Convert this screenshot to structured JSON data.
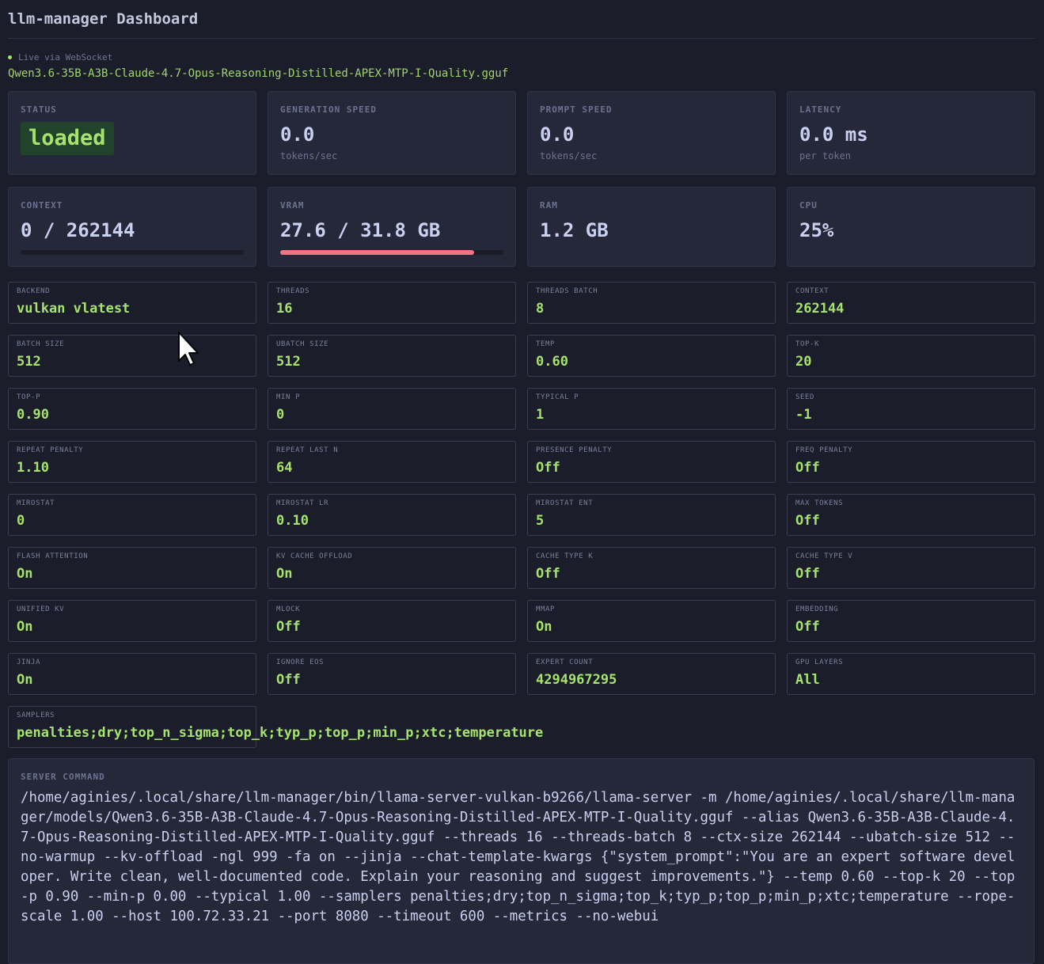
{
  "header": {
    "title": "llm-manager Dashboard"
  },
  "connection": {
    "status_text": "Live via WebSocket",
    "color": "#a6e36e"
  },
  "model": {
    "file": "Qwen3.6-35B-A3B-Claude-4.7-Opus-Reasoning-Distilled-APEX-MTP-I-Quality.gguf"
  },
  "stats": {
    "status": {
      "label": "STATUS",
      "value": "loaded"
    },
    "generation_speed": {
      "label": "GENERATION SPEED",
      "value": "0.0",
      "unit": "tokens/sec"
    },
    "prompt_speed": {
      "label": "PROMPT SPEED",
      "value": "0.0",
      "unit": "tokens/sec"
    },
    "latency": {
      "label": "LATENCY",
      "value": "0.0 ms",
      "unit": "per token"
    },
    "context": {
      "label": "CONTEXT",
      "value": "0 / 262144",
      "used_fraction": 0.0
    },
    "vram": {
      "label": "VRAM",
      "value": "27.6 / 31.8 GB",
      "used_fraction": 0.868
    },
    "ram": {
      "label": "RAM",
      "value": "1.2 GB"
    },
    "cpu": {
      "label": "CPU",
      "value": "25%"
    }
  },
  "config": [
    {
      "label": "BACKEND",
      "value": "vulkan vlatest"
    },
    {
      "label": "THREADS",
      "value": "16"
    },
    {
      "label": "THREADS BATCH",
      "value": "8"
    },
    {
      "label": "CONTEXT",
      "value": "262144"
    },
    {
      "label": "BATCH SIZE",
      "value": "512"
    },
    {
      "label": "UBATCH SIZE",
      "value": "512"
    },
    {
      "label": "TEMP",
      "value": "0.60"
    },
    {
      "label": "TOP-K",
      "value": "20"
    },
    {
      "label": "TOP-P",
      "value": "0.90"
    },
    {
      "label": "MIN P",
      "value": "0"
    },
    {
      "label": "TYPICAL P",
      "value": "1"
    },
    {
      "label": "SEED",
      "value": "-1"
    },
    {
      "label": "REPEAT PENALTY",
      "value": "1.10"
    },
    {
      "label": "REPEAT LAST N",
      "value": "64"
    },
    {
      "label": "PRESENCE PENALTY",
      "value": "Off"
    },
    {
      "label": "FREQ PENALTY",
      "value": "Off"
    },
    {
      "label": "MIROSTAT",
      "value": "0"
    },
    {
      "label": "MIROSTAT LR",
      "value": "0.10"
    },
    {
      "label": "MIROSTAT ENT",
      "value": "5"
    },
    {
      "label": "MAX TOKENS",
      "value": "Off"
    },
    {
      "label": "FLASH ATTENTION",
      "value": "On"
    },
    {
      "label": "KV CACHE OFFLOAD",
      "value": "On"
    },
    {
      "label": "CACHE TYPE K",
      "value": "Off"
    },
    {
      "label": "CACHE TYPE V",
      "value": "Off"
    },
    {
      "label": "UNIFIED KV",
      "value": "On"
    },
    {
      "label": "MLOCK",
      "value": "Off"
    },
    {
      "label": "MMAP",
      "value": "On"
    },
    {
      "label": "EMBEDDING",
      "value": "Off"
    },
    {
      "label": "JINJA",
      "value": "On"
    },
    {
      "label": "IGNORE EOS",
      "value": "Off"
    },
    {
      "label": "EXPERT COUNT",
      "value": "4294967295"
    },
    {
      "label": "GPU LAYERS",
      "value": "All"
    },
    {
      "label": "SAMPLERS",
      "value": "penalties;dry;top_n_sigma;top_k;typ_p;top_p;min_p;xtc;temperature"
    }
  ],
  "server_command": {
    "label": "SERVER COMMAND",
    "text": "/home/aginies/.local/share/llm-manager/bin/llama-server-vulkan-b9266/llama-server -m /home/aginies/.local/share/llm-manager/models/Qwen3.6-35B-A3B-Claude-4.7-Opus-Reasoning-Distilled-APEX-MTP-I-Quality.gguf --alias Qwen3.6-35B-A3B-Claude-4.7-Opus-Reasoning-Distilled-APEX-MTP-I-Quality.gguf --threads 16 --threads-batch 8 --ctx-size 262144 --ubatch-size 512 --no-warmup --kv-offload -ngl 999 -fa on --jinja --chat-template-kwargs {\"system_prompt\":\"You are an expert software developer. Write clean, well-documented code. Explain your reasoning and suggest improvements.\"} --temp 0.60 --top-k 20 --top-p 0.90 --min-p 0.00 --typical 1.00 --samplers penalties;dry;top_n_sigma;top_k;typ_p;top_p;min_p;xtc;temperature --rope-scale 1.00 --host 100.72.33.21 --port 8080 --timeout 600 --metrics --no-webui"
  }
}
